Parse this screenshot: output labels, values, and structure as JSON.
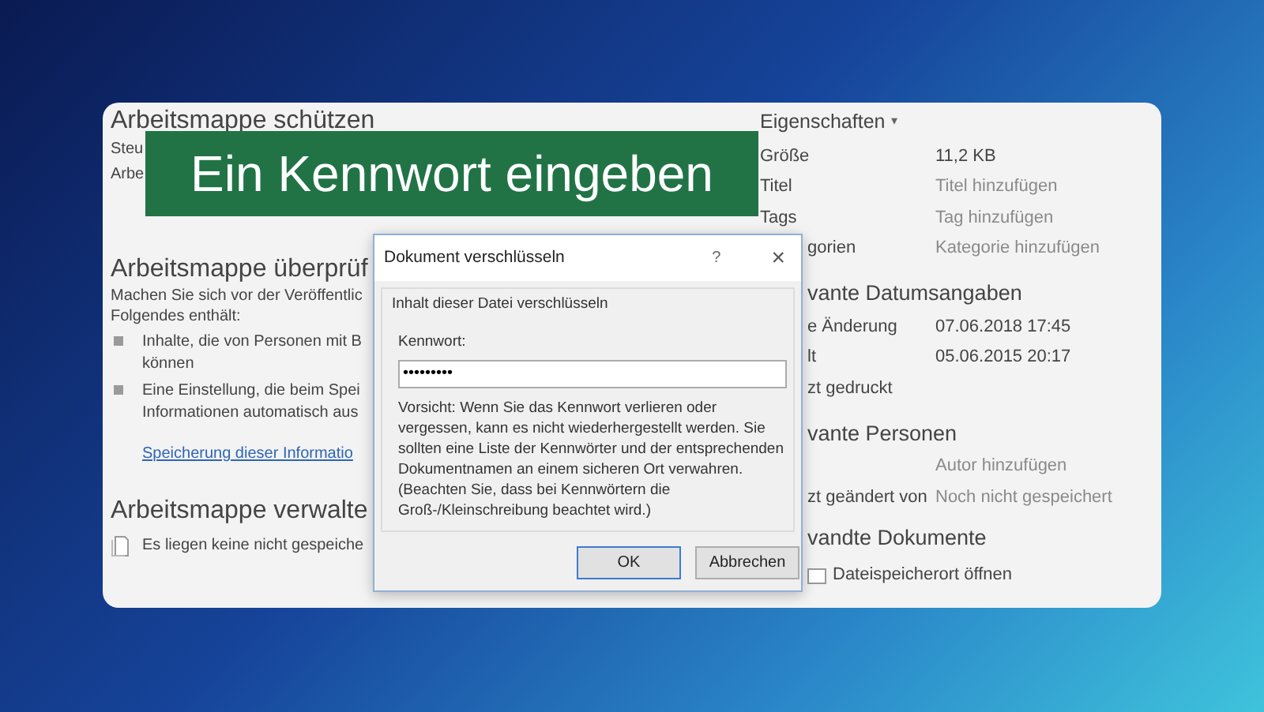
{
  "banner": {
    "text": "Ein Kennwort eingeben"
  },
  "left": {
    "protect": {
      "title": "Arbeitsmappe schützen",
      "lines": [
        "Steu",
        "Arbe"
      ]
    },
    "inspect": {
      "title": "Arbeitsmappe überprüf",
      "intro": [
        "Machen Sie sich vor der Veröffentlic",
        "Folgendes enthält:"
      ],
      "bullets": [
        [
          "Inhalte, die von Personen mit B",
          "können"
        ],
        [
          "Eine Einstellung, die beim Spei",
          "Informationen automatisch aus"
        ]
      ],
      "link": "Speicherung dieser Informatio"
    },
    "manage": {
      "title": "Arbeitsmappe verwalte",
      "note": "Es liegen keine nicht gespeiche"
    }
  },
  "right": {
    "properties": {
      "title": "Eigenschaften",
      "caret": "▾",
      "rows": [
        {
          "label": "Größe",
          "value": "11,2 KB",
          "muted": false,
          "clipped": false
        },
        {
          "label": "Titel",
          "value": "Titel hinzufügen",
          "muted": true,
          "clipped": false
        },
        {
          "label": "Tags",
          "value": "Tag hinzufügen",
          "muted": true,
          "clipped": false
        },
        {
          "label": "gorien",
          "value": "Kategorie hinzufügen",
          "muted": true,
          "clipped": true
        }
      ]
    },
    "sections": [
      {
        "title": "vante Datumsangaben",
        "rows": [
          {
            "label": "e Änderung",
            "value": "07.06.2018 17:45",
            "muted": false,
            "clipped": true
          },
          {
            "label": "lt",
            "value": "05.06.2015 20:17",
            "muted": false,
            "clipped": true
          },
          {
            "label": "zt gedruckt",
            "clipped": true
          }
        ]
      },
      {
        "title": "vante Personen",
        "rows": [
          {
            "value": "Autor hinzufügen",
            "muted": true,
            "clipped": true
          },
          {
            "label": "zt geändert von",
            "value": "Noch nicht gespeichert",
            "muted": true,
            "clipped": true
          }
        ]
      }
    ],
    "related": {
      "title": "vandte Dokumente",
      "link": "Dateispeicherort öffnen"
    }
  },
  "dialog": {
    "title": "Dokument verschlüsseln",
    "help": "?",
    "close": "×",
    "group_label": "Inhalt dieser Datei verschlüsseln",
    "field_label": "Kennwort:",
    "value": "•••••••••",
    "warning": "Vorsicht: Wenn Sie das Kennwort verlieren oder vergessen, kann es nicht wiederhergestellt werden. Sie sollten eine Liste der Kennwörter und der entsprechenden Dokumentnamen an einem sicheren Ort verwahren. (Beachten Sie, dass bei Kennwörtern die Groß-/Kleinschreibung beachtet wird.)",
    "buttons": [
      {
        "label": "OK",
        "default": true
      },
      {
        "label": "Abbrechen",
        "default": false
      }
    ]
  }
}
